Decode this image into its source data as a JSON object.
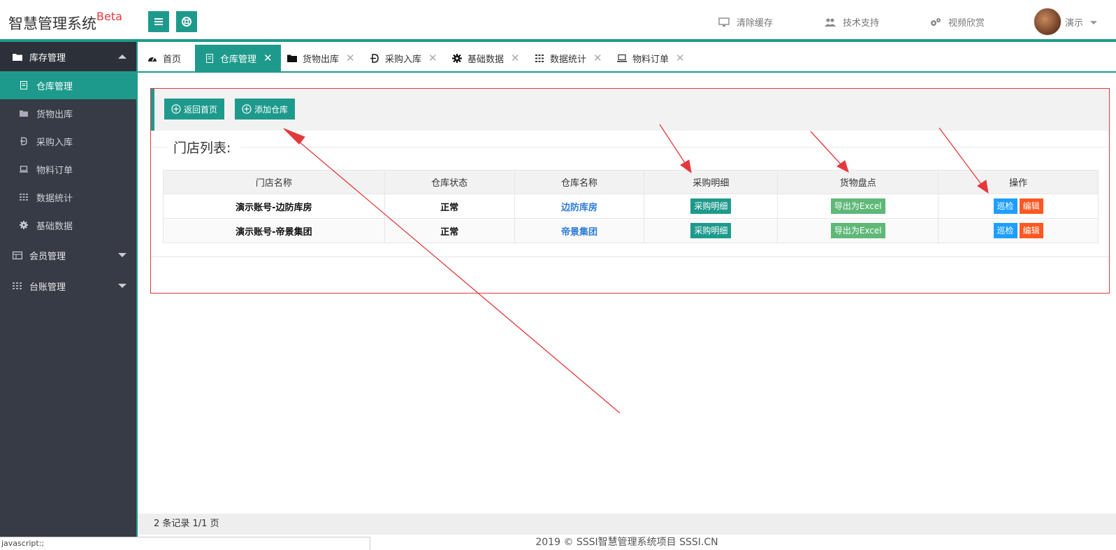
{
  "app": {
    "title": "智慧管理系统",
    "title_sup": "Beta"
  },
  "topnav": {
    "clear_cache": "清除缓存",
    "tech_support": "技术支持",
    "video": "视频欣赏",
    "user": "演示"
  },
  "sidebar": {
    "group_inventory": "库存管理",
    "items": [
      "仓库管理",
      "货物出库",
      "采购入库",
      "物料订单",
      "数据统计",
      "基础数据"
    ],
    "group_member": "会员管理",
    "group_ledger": "台账管理"
  },
  "tabs": [
    "首页",
    "仓库管理",
    "货物出库",
    "采购入库",
    "基础数据",
    "数据统计",
    "物料订单"
  ],
  "toolbar": {
    "back_home": "返回首页",
    "add_warehouse": "添加仓库"
  },
  "legend": "门店列表:",
  "table": {
    "headers": [
      "门店名称",
      "仓库状态",
      "仓库名称",
      "采购明细",
      "货物盘点",
      "操作"
    ],
    "rows": [
      {
        "store": "演示账号-边防库房",
        "status": "正常",
        "warehouse": "边防库房",
        "purchase": "采购明细",
        "export": "导出为Excel",
        "inspect": "巡检",
        "edit": "编辑"
      },
      {
        "store": "演示账号-帝景集团",
        "status": "正常",
        "warehouse": "帝景集团",
        "purchase": "采购明细",
        "export": "导出为Excel",
        "inspect": "巡检",
        "edit": "编辑"
      }
    ]
  },
  "pager": "2 条记录 1/1 页",
  "footer": "2019 ©  SSSI智慧管理系统项目  SSSI.CN",
  "statusbar": "javascript:;",
  "colors": {
    "accent": "#1e9a8c",
    "sidebar_bg": "#363b45",
    "annotation": "#e4393c"
  }
}
